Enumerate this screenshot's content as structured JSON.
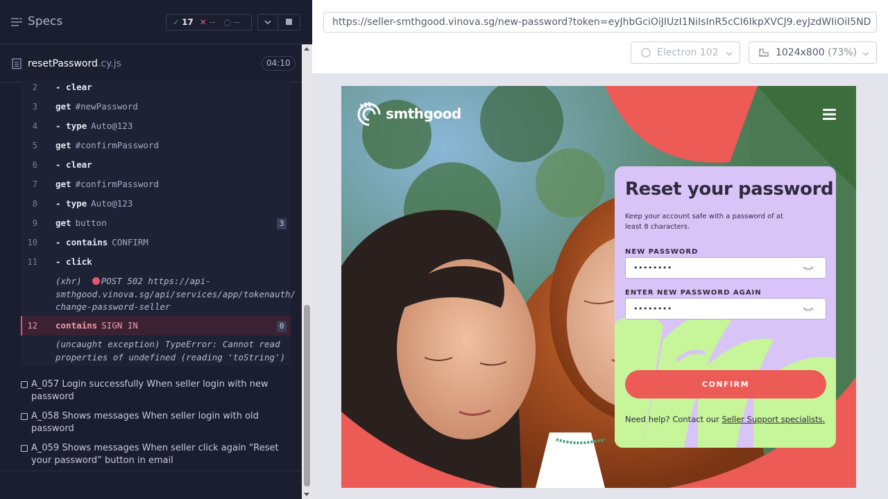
{
  "specs_header": {
    "title": "Specs",
    "passed": "17",
    "failed": "--",
    "pending": "--"
  },
  "file": {
    "name": "resetPassword",
    "ext": ".cy.js",
    "duration": "04:10"
  },
  "commands": [
    {
      "num": "2",
      "cmd": "- clear",
      "arg": ""
    },
    {
      "num": "3",
      "cmd": "get",
      "arg": "#newPassword"
    },
    {
      "num": "4",
      "cmd": "- type",
      "arg": "Auto@123"
    },
    {
      "num": "5",
      "cmd": "get",
      "arg": "#confirmPassword"
    },
    {
      "num": "6",
      "cmd": "- clear",
      "arg": ""
    },
    {
      "num": "7",
      "cmd": "get",
      "arg": "#confirmPassword"
    },
    {
      "num": "8",
      "cmd": "- type",
      "arg": "Auto@123"
    },
    {
      "num": "9",
      "cmd": "get",
      "arg": "button",
      "badge": "3"
    },
    {
      "num": "10",
      "cmd": "- contains",
      "arg": "CONFIRM"
    },
    {
      "num": "11",
      "cmd": "- click",
      "arg": ""
    }
  ],
  "xhr": {
    "prefix": "(xhr)",
    "line1": "POST 502 https://api-",
    "line2": "smthgood.vinova.sg/api/services/app/tokenauth/",
    "line3": "change-password-seller"
  },
  "failed_command": {
    "num": "12",
    "cmd": "contains",
    "arg": "SIGN IN",
    "badge": "0"
  },
  "error": {
    "line1": "(uncaught exception)  TypeError: Cannot read",
    "line2": "properties of undefined (reading 'toString')"
  },
  "tests": [
    {
      "line1": "A_057 Login successfully When seller login with new",
      "line2": "password"
    },
    {
      "line1": "A_058 Shows messages When seller login with old",
      "line2": "password"
    },
    {
      "line1": "A_059 Shows messages When seller click again “Reset",
      "line2": "your password” button in email"
    }
  ],
  "toolbar": {
    "url": "https://seller-smthgood.vinova.sg/new-password?token=eyJhbGciOiJIUzI1NiIsInR5cCI6IkpXVCJ9.eyJzdWIiOiI5ND",
    "browser": "Electron 102",
    "viewport": "1024x800",
    "zoom": "(73%)"
  },
  "app": {
    "logo": "smthgood",
    "card_title": "Reset your password",
    "card_desc": "Keep your account safe with a password of at least 8 characters.",
    "new_password_label": "NEW PASSWORD",
    "new_password_value": "••••••••",
    "confirm_password_label": "ENTER NEW PASSWORD AGAIN",
    "confirm_password_value": "••••••••",
    "confirm_button": "CONFIRM",
    "help_text": "Need help? Contact our ",
    "help_link": "Seller Support specialists."
  },
  "colors": {
    "accent_red": "#ec5b56",
    "card_lavender": "#d9c4f8",
    "deco_lime": "#c6f59a",
    "pass_green": "#1fa971",
    "fail_red": "#e45770"
  }
}
